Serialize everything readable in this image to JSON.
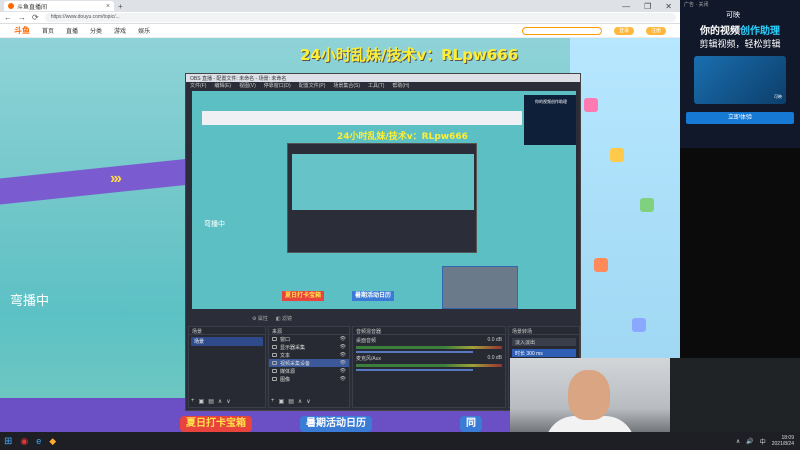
{
  "browser": {
    "tab_title": "斗鱼直播间",
    "tab_close": "×",
    "new_tab": "+",
    "url": "https://www.douyu.com/topic/...",
    "nav_back": "←",
    "nav_forward": "→",
    "nav_refresh": "⟳",
    "win_min": "—",
    "win_max": "❐",
    "win_close": "✕"
  },
  "site_header": {
    "logo": "斗鱼",
    "nav": [
      "首页",
      "直播",
      "分类",
      "游戏",
      "娱乐"
    ],
    "login_label": "登录",
    "register_label": "注册"
  },
  "stream": {
    "title": "24小时乱妹/技术v：RLpw666",
    "live_label": "弯播中",
    "banners": [
      "夏日打卡宝箱",
      "暑期活动日历",
      "同"
    ],
    "chevrons": "›››"
  },
  "obs": {
    "window_title": "OBS 直播 - 配置文件: 未命名 - 场景: 未命名",
    "menu": [
      "文件(F)",
      "编辑(E)",
      "视图(V)",
      "停靠窗口(D)",
      "配置文件(P)",
      "场景集合(S)",
      "工具(T)",
      "帮助(H)"
    ],
    "inner_title": "24小时乱妹/技术v：RLpw666",
    "inner_live": "弯播中",
    "inner_ad": "你的视频创作助理",
    "inner_banners": [
      "夏日打卡宝箱",
      "暑期活动日历"
    ],
    "toolbar": [
      "⚙ 属性",
      "◧ 滤镜"
    ],
    "docks": {
      "scenes": {
        "header": "场景",
        "items": [
          "场景"
        ]
      },
      "sources": {
        "header": "来源",
        "items": [
          {
            "label": "窗口",
            "selected": false
          },
          {
            "label": "显示器采集",
            "selected": false
          },
          {
            "label": "文本",
            "selected": false
          },
          {
            "label": "视频采集设备",
            "selected": true
          },
          {
            "label": "媒体源",
            "selected": false
          },
          {
            "label": "图像",
            "selected": false
          }
        ]
      },
      "mixer": {
        "header": "音频混音器",
        "channels": [
          {
            "name": "桌面音频",
            "level": "0.0 dB"
          },
          {
            "name": "麦克风/Aux",
            "level": "0.0 dB"
          }
        ]
      },
      "transitions": {
        "header": "场景转场",
        "type": "淡入淡出",
        "duration": "时长 300 ms"
      }
    },
    "dock_controls": [
      "+",
      "▣",
      "▤",
      "∧",
      "∨"
    ]
  },
  "ad": {
    "top_label": "广告 · 关闭",
    "brand": "可映",
    "headline_a": "你的视频",
    "headline_b": "创作助理",
    "sub": "剪辑视频，轻松剪辑",
    "image_caption": "可映",
    "button": "立即体验"
  },
  "taskbar": {
    "start_icon": "⊞",
    "icons": [
      "◉",
      "e",
      "◆"
    ],
    "tray": [
      "∧",
      "🔊",
      "中"
    ],
    "time": "18:09",
    "date": "2021/8/24"
  },
  "colors": {
    "title_yellow": "#ffee33",
    "obs_bg": "#2b2e38",
    "selected_blue": "#3b5998",
    "ad_bg": "#10182a"
  }
}
